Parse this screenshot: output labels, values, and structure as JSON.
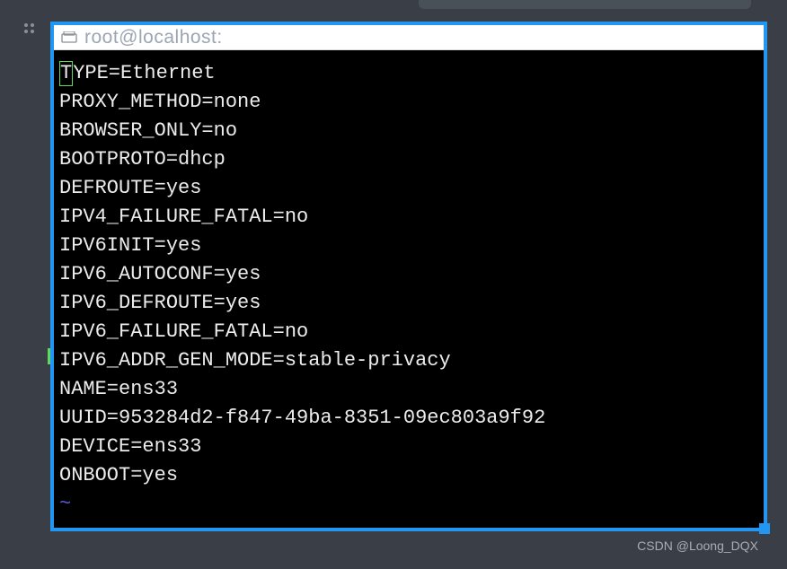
{
  "titlebar": {
    "title": "root@localhost:"
  },
  "config": {
    "lines": [
      {
        "key": "TYPE",
        "value": "Ethernet"
      },
      {
        "key": "PROXY_METHOD",
        "value": "none"
      },
      {
        "key": "BROWSER_ONLY",
        "value": "no"
      },
      {
        "key": "BOOTPROTO",
        "value": "dhcp"
      },
      {
        "key": "DEFROUTE",
        "value": "yes"
      },
      {
        "key": "IPV4_FAILURE_FATAL",
        "value": "no"
      },
      {
        "key": "IPV6INIT",
        "value": "yes"
      },
      {
        "key": "IPV6_AUTOCONF",
        "value": "yes"
      },
      {
        "key": "IPV6_DEFROUTE",
        "value": "yes"
      },
      {
        "key": "IPV6_FAILURE_FATAL",
        "value": "no"
      },
      {
        "key": "IPV6_ADDR_GEN_MODE",
        "value": "stable-privacy"
      },
      {
        "key": "NAME",
        "value": "ens33"
      },
      {
        "key": "UUID",
        "value": "953284d2-f847-49ba-8351-09ec803a9f92"
      },
      {
        "key": "DEVICE",
        "value": "ens33"
      },
      {
        "key": "ONBOOT",
        "value": "yes"
      }
    ],
    "first_char": "T",
    "first_rest": "YPE=Ethernet",
    "line1": "PROXY_METHOD=none",
    "line2": "BROWSER_ONLY=no",
    "line3": "BOOTPROTO=dhcp",
    "line4": "DEFROUTE=yes",
    "line5": "IPV4_FAILURE_FATAL=no",
    "line6": "IPV6INIT=yes",
    "line7": "IPV6_AUTOCONF=yes",
    "line8": "IPV6_DEFROUTE=yes",
    "line9": "IPV6_FAILURE_FATAL=no",
    "line10": "IPV6_ADDR_GEN_MODE=stable-privacy",
    "line11": "NAME=ens33",
    "line12": "UUID=953284d2-f847-49ba-8351-09ec803a9f92",
    "line13": "DEVICE=ens33",
    "line14": "ONBOOT=yes",
    "tilde": "~"
  },
  "watermark": "CSDN @Loong_DQX"
}
